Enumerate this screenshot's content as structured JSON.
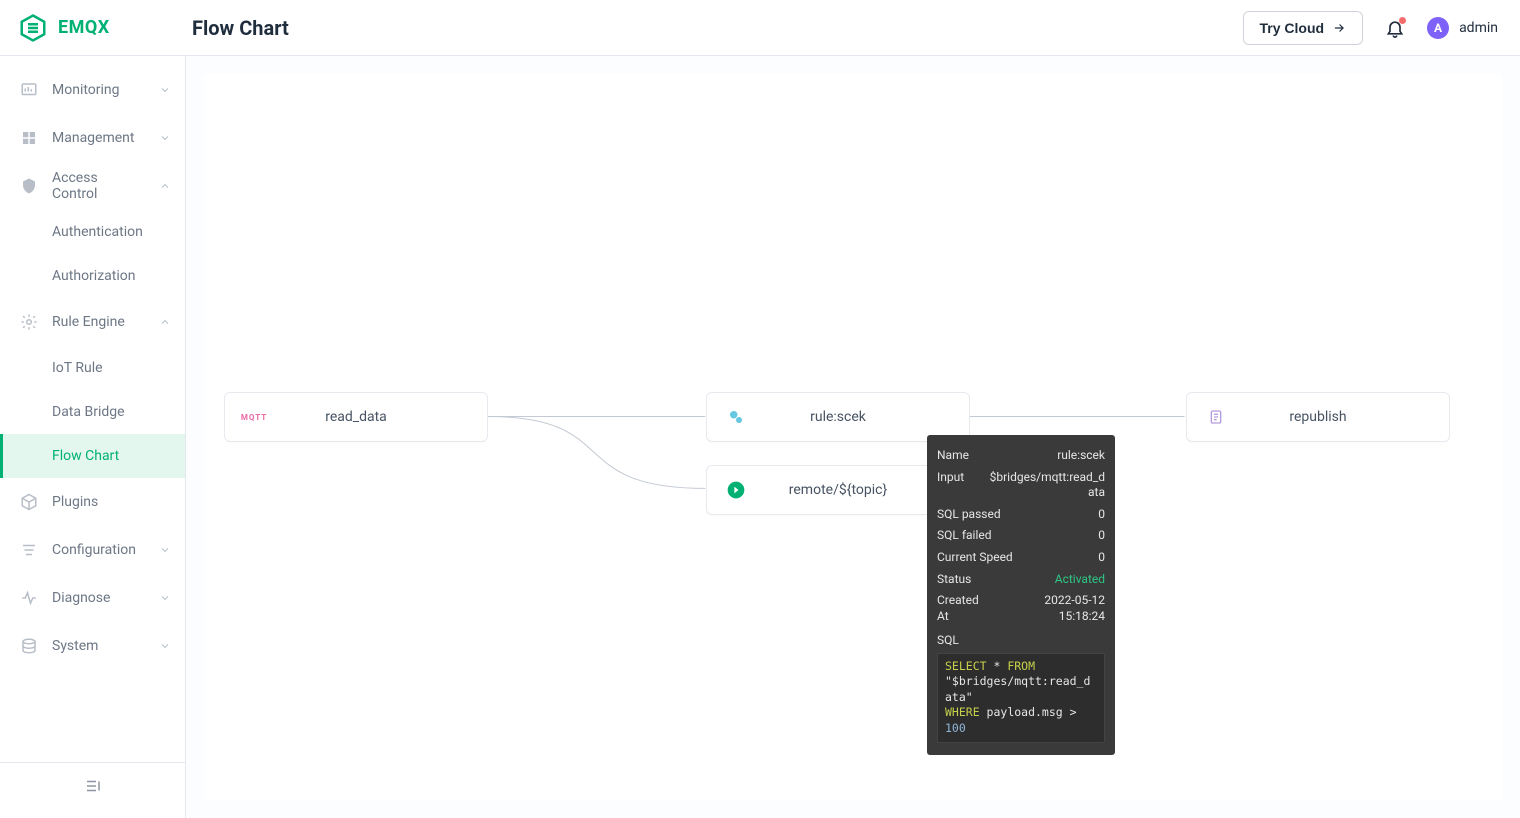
{
  "brand": "EMQX",
  "page_title": "Flow Chart",
  "header": {
    "try_cloud": "Try Cloud",
    "avatar_letter": "A",
    "user_name": "admin"
  },
  "sidebar": {
    "items": [
      {
        "label": "Monitoring",
        "expandable": true,
        "expanded": false
      },
      {
        "label": "Management",
        "expandable": true,
        "expanded": false
      },
      {
        "label": "Access Control",
        "expandable": true,
        "expanded": true,
        "children": [
          {
            "label": "Authentication"
          },
          {
            "label": "Authorization"
          }
        ]
      },
      {
        "label": "Rule Engine",
        "expandable": true,
        "expanded": true,
        "children": [
          {
            "label": "IoT Rule"
          },
          {
            "label": "Data Bridge"
          },
          {
            "label": "Flow Chart",
            "active": true
          }
        ]
      },
      {
        "label": "Plugins",
        "expandable": false
      },
      {
        "label": "Configuration",
        "expandable": true,
        "expanded": false
      },
      {
        "label": "Diagnose",
        "expandable": true,
        "expanded": false
      },
      {
        "label": "System",
        "expandable": true,
        "expanded": false
      }
    ]
  },
  "nodes": {
    "read_data": "read_data",
    "rule": "rule:scek",
    "remote": "remote/${topic}",
    "republish": "republish"
  },
  "tooltip": {
    "rows": [
      {
        "k": "Name",
        "v": "rule:scek"
      },
      {
        "k": "Input",
        "v": "$bridges/mqtt:read_data"
      },
      {
        "k": "SQL passed",
        "v": "0"
      },
      {
        "k": "SQL failed",
        "v": "0"
      },
      {
        "k": "Current Speed",
        "v": "0"
      },
      {
        "k": "Status",
        "v": "Activated",
        "status": true
      },
      {
        "k": "Created At",
        "v": "2022-05-12 15:18:24"
      }
    ],
    "sql_label": "SQL",
    "sql": {
      "select": "SELECT",
      "star_from": " * ",
      "from": "FROM",
      "src": "\"$bridges/mqtt:read_data\"",
      "where": "WHERE",
      "cond": " payload.msg > ",
      "num": "100"
    }
  }
}
